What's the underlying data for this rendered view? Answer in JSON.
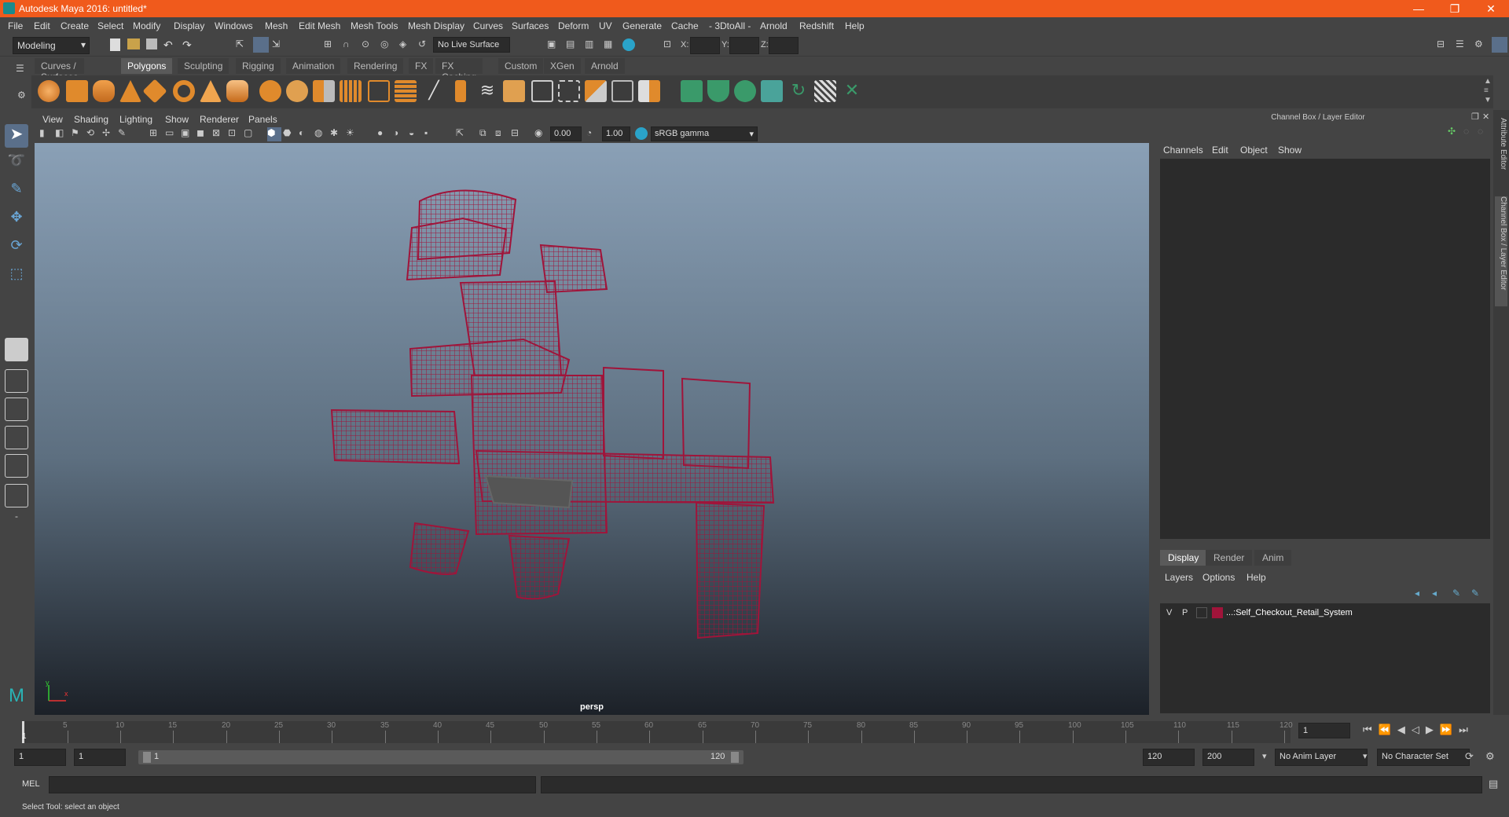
{
  "window": {
    "title": "Autodesk Maya 2016: untitled*",
    "minimize": "—",
    "restore": "❐",
    "close": "✕"
  },
  "menu": [
    "File",
    "Edit",
    "Create",
    "Select",
    "Modify",
    "Display",
    "Windows",
    "Mesh",
    "Edit Mesh",
    "Mesh Tools",
    "Mesh Display",
    "Curves",
    "Surfaces",
    "Deform",
    "UV",
    "Generate",
    "Cache",
    "- 3DtoAll -",
    "Arnold",
    "Redshift",
    "Help"
  ],
  "status": {
    "mode": "Modeling",
    "live_surface": "No Live Surface",
    "x_label": "X:",
    "y_label": "Y:",
    "z_label": "Z:"
  },
  "shelf_tabs": [
    "Curves / Surfaces",
    "Polygons",
    "Sculpting",
    "Rigging",
    "Animation",
    "Rendering",
    "FX",
    "FX Caching",
    "Custom",
    "XGen",
    "Arnold"
  ],
  "shelf_active": "Polygons",
  "viewport": {
    "menu": [
      "View",
      "Shading",
      "Lighting",
      "Show",
      "Renderer",
      "Panels"
    ],
    "exposure": "0.00",
    "gamma": "1.00",
    "color_space": "sRGB gamma",
    "camera_label": "persp",
    "axis_x": "x",
    "axis_y": "y"
  },
  "channel_box": {
    "title": "Channel Box / Layer Editor",
    "menu": [
      "Channels",
      "Edit",
      "Object",
      "Show"
    ]
  },
  "layer_editor": {
    "tabs": [
      "Display",
      "Render",
      "Anim"
    ],
    "menu": [
      "Layers",
      "Options",
      "Help"
    ],
    "layer": {
      "v": "V",
      "p": "P",
      "name": "...:Self_Checkout_Retail_System",
      "color": "#a0143a"
    }
  },
  "side_tabs": [
    "Attribute Editor",
    "Channel Box / Layer Editor"
  ],
  "timeline": {
    "ticks": [
      "5",
      "10",
      "15",
      "20",
      "25",
      "30",
      "35",
      "40",
      "45",
      "50",
      "55",
      "60",
      "65",
      "70",
      "75",
      "80",
      "85",
      "90",
      "95",
      "100",
      "105",
      "110",
      "115",
      "120"
    ],
    "current_frame": "1",
    "frame_field": "1"
  },
  "range": {
    "start": "1",
    "anim_start": "1",
    "slider_start": "1",
    "slider_end": "120",
    "anim_end": "120",
    "end": "200",
    "anim_layer": "No Anim Layer",
    "char_set": "No Character Set"
  },
  "command": {
    "label": "MEL"
  },
  "help_line": "Select Tool: select an object",
  "colors": {
    "accent": "#f05a1c",
    "wireframe": "#a0143a"
  }
}
